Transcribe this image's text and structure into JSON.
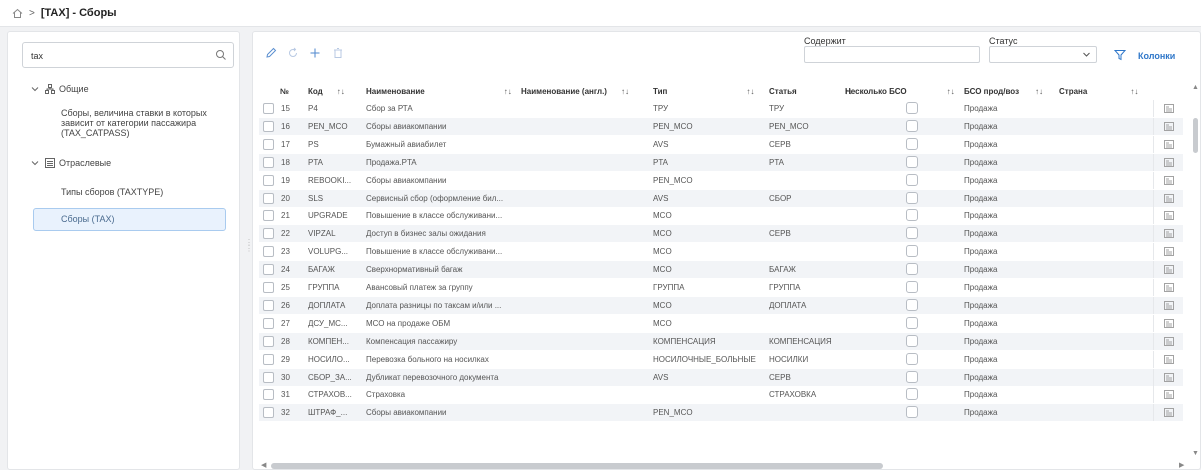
{
  "breadcrumb": {
    "separator": ">",
    "title": "[TAX] - Сборы"
  },
  "sidebar": {
    "search_value": "tax",
    "groups": [
      {
        "label": "Общие",
        "icon": "org-chart-icon",
        "children": [
          "Сборы, величина ставки в которых зависит от категории пассажира (TAX_CATPASS)"
        ]
      },
      {
        "label": "Отраслевые",
        "icon": "list-icon",
        "children": [
          "Типы сборов (TAXTYPE)",
          "Сборы (TAX)"
        ]
      }
    ],
    "selected": "Сборы (TAX)"
  },
  "toolbar": {
    "icons": [
      "edit-icon",
      "refresh-icon",
      "add-icon",
      "delete-icon"
    ],
    "contains_label": "Содержит",
    "contains_value": "",
    "status_label": "Статус",
    "status_value": "",
    "columns_label": "Колонки"
  },
  "table": {
    "columns": [
      "№",
      "Код",
      "Наименование",
      "Наименование (англ.)",
      "Тип",
      "Статья",
      "Несколько БСО",
      "БСО прод/воз",
      "Страна"
    ],
    "rows": [
      {
        "n": "15",
        "code": "P4",
        "name": "Сбор за РТА",
        "name_en": "",
        "type": "ТРУ",
        "article": "ТРУ",
        "bso": "Продажа"
      },
      {
        "n": "16",
        "code": "PEN_MCO",
        "name": "Сборы авиакомпании",
        "name_en": "",
        "type": "PEN_MCO",
        "article": "PEN_MCO",
        "bso": "Продажа"
      },
      {
        "n": "17",
        "code": "PS",
        "name": "Бумажный авиабилет",
        "name_en": "",
        "type": "AVS",
        "article": "CEPB",
        "bso": "Продажа"
      },
      {
        "n": "18",
        "code": "PTA",
        "name": "Продажа.PTA",
        "name_en": "",
        "type": "PTA",
        "article": "PTA",
        "bso": "Продажа"
      },
      {
        "n": "19",
        "code": "REBOOKI...",
        "name": "Сборы авиакомпании",
        "name_en": "",
        "type": "PEN_MCO",
        "article": "",
        "bso": "Продажа"
      },
      {
        "n": "20",
        "code": "SLS",
        "name": "Сервисный сбор (оформление бил...",
        "name_en": "",
        "type": "AVS",
        "article": "СБОР",
        "bso": "Продажа"
      },
      {
        "n": "21",
        "code": "UPGRADE",
        "name": "Повышение в классе обслуживани...",
        "name_en": "",
        "type": "MCO",
        "article": "",
        "bso": "Продажа"
      },
      {
        "n": "22",
        "code": "VIPZAL",
        "name": "Доступ в бизнес залы ожидания",
        "name_en": "",
        "type": "MCO",
        "article": "CEPB",
        "bso": "Продажа"
      },
      {
        "n": "23",
        "code": "VOLUPG...",
        "name": "Повышение в классе обслуживани...",
        "name_en": "",
        "type": "MCO",
        "article": "",
        "bso": "Продажа"
      },
      {
        "n": "24",
        "code": "БАГАЖ",
        "name": "Сверхнормативный багаж",
        "name_en": "",
        "type": "MCO",
        "article": "БАГАЖ",
        "bso": "Продажа"
      },
      {
        "n": "25",
        "code": "ГРУППА",
        "name": "Авансовый платеж за группу",
        "name_en": "",
        "type": "ГРУППА",
        "article": "ГРУППА",
        "bso": "Продажа"
      },
      {
        "n": "26",
        "code": "ДОПЛАТА",
        "name": "Доплата разницы по таксам и/или ...",
        "name_en": "",
        "type": "MCO",
        "article": "ДОПЛАТА",
        "bso": "Продажа"
      },
      {
        "n": "27",
        "code": "ДСУ_МС...",
        "name": "МСО на продаже ОБМ",
        "name_en": "",
        "type": "MCO",
        "article": "",
        "bso": "Продажа"
      },
      {
        "n": "28",
        "code": "КОМПЕН...",
        "name": "Компенсация пассажиру",
        "name_en": "",
        "type": "КОМПЕНСАЦИЯ",
        "article": "КОМПЕНСАЦИЯ",
        "bso": "Продажа"
      },
      {
        "n": "29",
        "code": "НОСИЛО...",
        "name": "Перевозка больного на носилках",
        "name_en": "",
        "type": "НОСИЛОЧНЫЕ_БОЛЬНЫЕ",
        "article": "НОСИЛКИ",
        "bso": "Продажа"
      },
      {
        "n": "30",
        "code": "СБОР_ЗА...",
        "name": "Дубликат перевозочного документа",
        "name_en": "",
        "type": "AVS",
        "article": "CEPB",
        "bso": "Продажа"
      },
      {
        "n": "31",
        "code": "СТРАХОВ...",
        "name": "Страховка",
        "name_en": "",
        "type": "",
        "article": "СТРАХОВКА",
        "bso": "Продажа"
      },
      {
        "n": "32",
        "code": "ШТРАФ_...",
        "name": "Сборы авиакомпании",
        "name_en": "",
        "type": "PEN_MCO",
        "article": "",
        "bso": "Продажа"
      }
    ]
  },
  "colors": {
    "accent": "#2f77c9",
    "selected_bg": "#e9f2fd",
    "row_shade": "#f2f4f7"
  }
}
